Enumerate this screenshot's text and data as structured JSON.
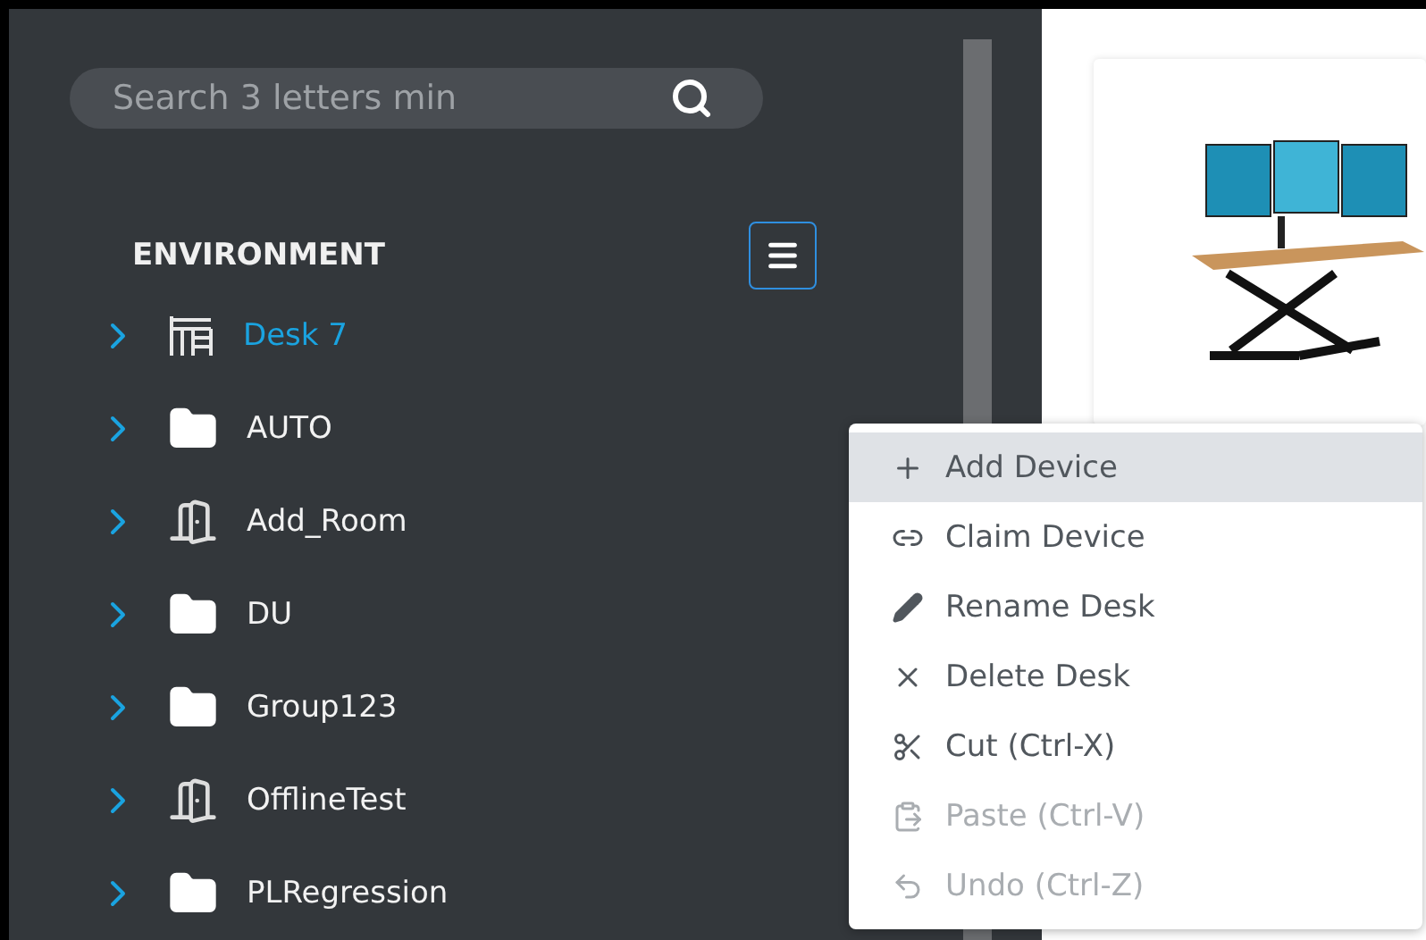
{
  "search": {
    "placeholder": "Search 3 letters min"
  },
  "tree": {
    "title": "ENVIRONMENT",
    "items": [
      {
        "label": "Desk 7",
        "kind": "desk",
        "selected": true
      },
      {
        "label": "AUTO",
        "kind": "folder",
        "selected": false
      },
      {
        "label": "Add_Room",
        "kind": "room",
        "selected": false
      },
      {
        "label": "DU",
        "kind": "folder",
        "selected": false
      },
      {
        "label": "Group123",
        "kind": "folder",
        "selected": false
      },
      {
        "label": "OfflineTest",
        "kind": "room",
        "selected": false
      },
      {
        "label": "PLRegression",
        "kind": "folder",
        "selected": false
      }
    ]
  },
  "context_menu": {
    "items": [
      {
        "label": "Add Device",
        "kind": "plus",
        "highlighted": true,
        "disabled": false
      },
      {
        "label": "Claim Device",
        "kind": "link",
        "highlighted": false,
        "disabled": false
      },
      {
        "label": "Rename Desk",
        "kind": "pencil",
        "highlighted": false,
        "disabled": false
      },
      {
        "label": "Delete Desk",
        "kind": "x",
        "highlighted": false,
        "disabled": false
      },
      {
        "label": "Cut (Ctrl-X)",
        "kind": "scissors",
        "highlighted": false,
        "disabled": false
      },
      {
        "label": "Paste (Ctrl-V)",
        "kind": "paste",
        "highlighted": false,
        "disabled": true
      },
      {
        "label": "Undo (Ctrl-Z)",
        "kind": "undo",
        "highlighted": false,
        "disabled": true
      }
    ]
  }
}
